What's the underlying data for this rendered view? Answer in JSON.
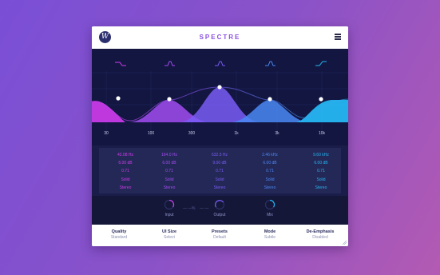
{
  "app": {
    "title": "SPECTRE"
  },
  "axis": {
    "freqs": [
      "30",
      "100",
      "300",
      "1k",
      "3k",
      "10k"
    ]
  },
  "bands": [
    {
      "freq": "42.08 Hz",
      "gain": "6.00 dB",
      "q": "0.71",
      "mode": "Solid",
      "channel": "Stereo",
      "color": "#d23cf0",
      "filter": "high-pass-filter-icon"
    },
    {
      "freq": "164.0 Hz",
      "gain": "6.00 dB",
      "q": "0.71",
      "mode": "Solid",
      "channel": "Stereo",
      "color": "#a24cf2",
      "filter": "bell-filter-icon"
    },
    {
      "freq": "632.5 Hz",
      "gain": "9.00 dB",
      "q": "0.71",
      "mode": "Solid",
      "channel": "Stereo",
      "color": "#7a5cf6",
      "filter": "bell-filter-icon"
    },
    {
      "freq": "2.46 kHz",
      "gain": "6.00 dB",
      "q": "0.71",
      "mode": "Solid",
      "channel": "Stereo",
      "color": "#4a88f4",
      "filter": "bell-filter-icon"
    },
    {
      "freq": "9.60 kHz",
      "gain": "6.00 dB",
      "q": "0.71",
      "mode": "Solid",
      "channel": "Stereo",
      "color": "#26b6f2",
      "filter": "high-shelf-filter-icon"
    }
  ],
  "knobs": {
    "input": "Input",
    "output": "Output",
    "mix": "Mix",
    "link": "%"
  },
  "footer": [
    {
      "label": "Quality",
      "value": "Standard"
    },
    {
      "label": "UI Size",
      "value": "Select"
    },
    {
      "label": "Presets",
      "value": "Default"
    },
    {
      "label": "Mode",
      "value": "Subtle"
    },
    {
      "label": "De-Emphasis",
      "value": "Disabled"
    }
  ]
}
